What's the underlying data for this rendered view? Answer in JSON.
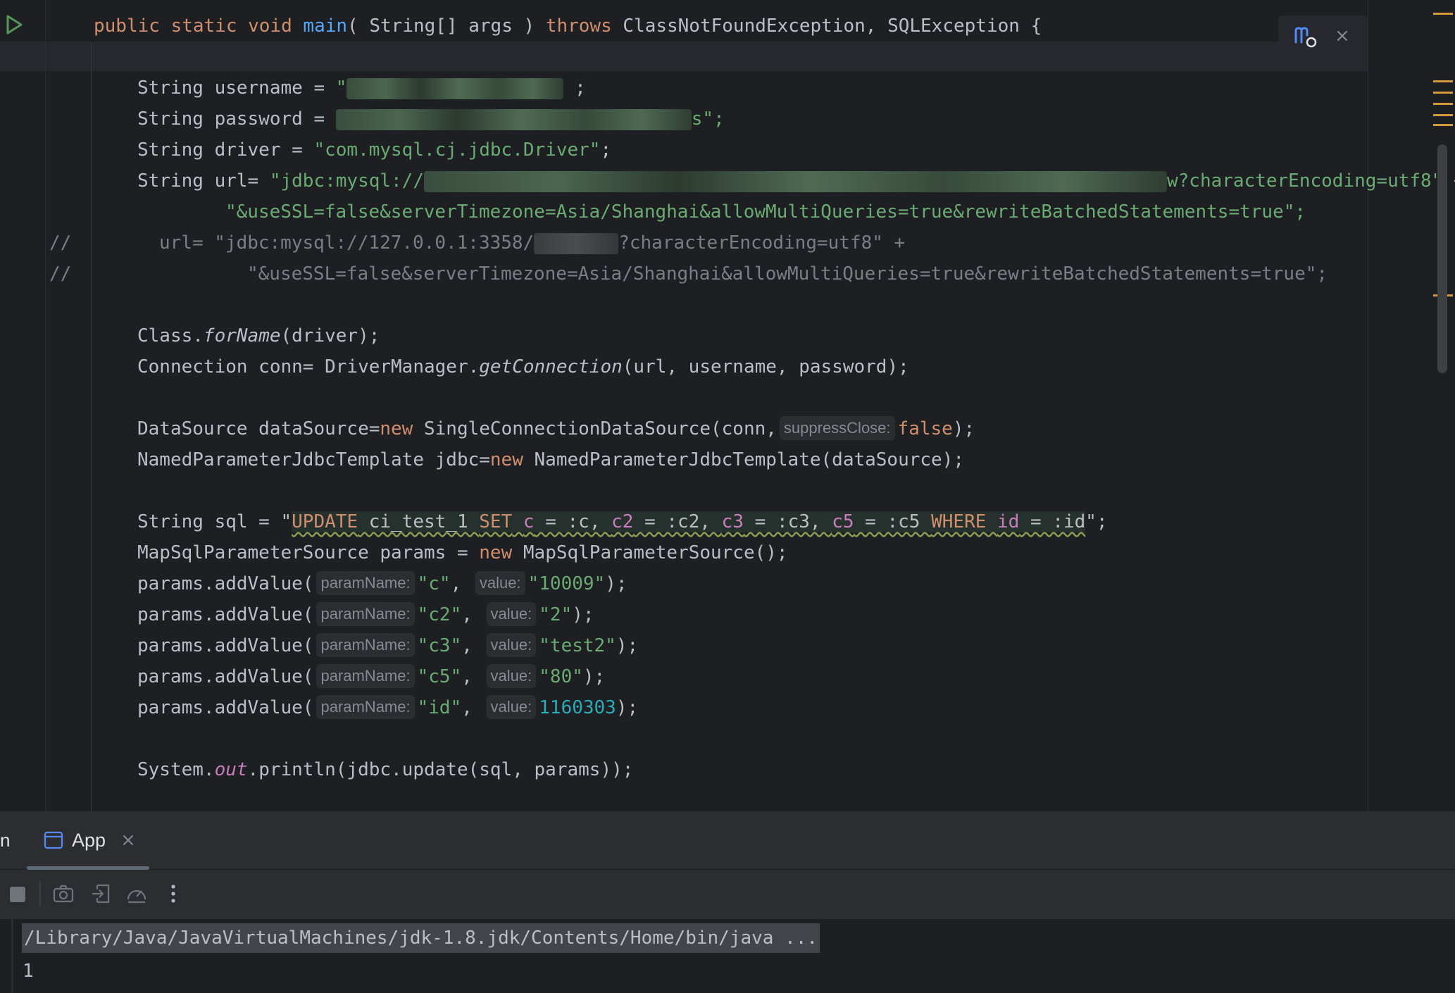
{
  "editor": {
    "signature": {
      "mods": "public static void",
      "name": "main",
      "params": "( String[] args )",
      "throws_kw": "throws",
      "exceptions": "ClassNotFoundException, SQLException {"
    },
    "username": {
      "prefix": "String username = ",
      "quote": "\"",
      "suffix": " ;"
    },
    "password": {
      "prefix": "String password = ",
      "suffix": "s\";"
    },
    "driver": {
      "prefix": "String driver = ",
      "value": "\"com.mysql.cj.jdbc.Driver\"",
      "suffix": ";"
    },
    "url": {
      "prefix": "String url= ",
      "start": "\"jdbc:mysql://",
      "end": "w?characterEncoding=utf8\"",
      "plus": "+",
      "cont": "\"&useSSL=false&serverTimezone=Asia/Shanghai&allowMultiQueries=true&rewriteBatchedStatements=true\";"
    },
    "comment1": {
      "marker": "//",
      "text": "url= \"jdbc:mysql://127.0.0.1:3358/",
      "text2": "?characterEncoding=utf8\" +"
    },
    "comment2": {
      "marker": "//",
      "text": "\"&useSSL=false&serverTimezone=Asia/Shanghai&allowMultiQueries=true&rewriteBatchedStatements=true\";"
    },
    "forname": {
      "a": "Class.",
      "b": "forName",
      "c": "(driver);"
    },
    "conn": {
      "a": "Connection conn= DriverManager.",
      "b": "getConnection",
      "c": "(url, username, password);"
    },
    "datasource": {
      "a": "DataSource dataSource=",
      "kw": "new",
      "b": " SingleConnectionDataSource(conn,",
      "hint": "suppressClose:",
      "val": "false",
      "c": ");"
    },
    "jdbc": {
      "a": "NamedParameterJdbcTemplate jdbc=",
      "kw": "new",
      "b": " NamedParameterJdbcTemplate(dataSource);"
    },
    "sql": {
      "a": "String sql = \"",
      "update": "UPDATE",
      "table": " ci_test_1 ",
      "set": "SET",
      "sp1": " ",
      "c": "c",
      "e1": " = :c, ",
      "c2": "c2",
      "e2": " = :c2, ",
      "c3": "c3",
      "e3": " = :c3, ",
      "c5": "c5",
      "e4": " = :c5 ",
      "where": "WHERE",
      "sp2": " ",
      "id": "id",
      "e5": " = :id",
      "end": "\";"
    },
    "paramsrc": {
      "a": "MapSqlParameterSource params = ",
      "kw": "new",
      "b": " MapSqlParameterSource();"
    },
    "param_hint_name": "paramName:",
    "param_hint_value": "value:",
    "param_call": "params.addValue(",
    "params": [
      {
        "name": "\"c\"",
        "value": "\"10009\"",
        "numeric": false
      },
      {
        "name": "\"c2\"",
        "value": "\"2\"",
        "numeric": false
      },
      {
        "name": "\"c3\"",
        "value": "\"test2\"",
        "numeric": false
      },
      {
        "name": "\"c5\"",
        "value": "\"80\"",
        "numeric": false
      },
      {
        "name": "\"id\"",
        "value": "1160303",
        "numeric": true
      }
    ],
    "println": {
      "a": "System.",
      "b": "out",
      "c": ".println(jdbc.update(sql, params));"
    }
  },
  "run_panel": {
    "tab_label": "App",
    "tab_left_stub": "n",
    "console_command": "/Library/Java/JavaVirtualMachines/jdk-1.8.jdk/Contents/Home/bin/java ...",
    "console_output": "1"
  },
  "icons": [
    "run-gutter-icon",
    "maven-reload-icon",
    "close-icon",
    "app-run-config-icon",
    "stop-icon",
    "camera-icon",
    "exit-icon",
    "profiler-icon",
    "more-vertical-icon"
  ],
  "colors": {
    "keyword": "#cf8e6d",
    "string": "#6aab73",
    "function": "#56a8f5",
    "number": "#2aacb8",
    "static_field": "#c77dbb",
    "background": "#1e1f22"
  }
}
